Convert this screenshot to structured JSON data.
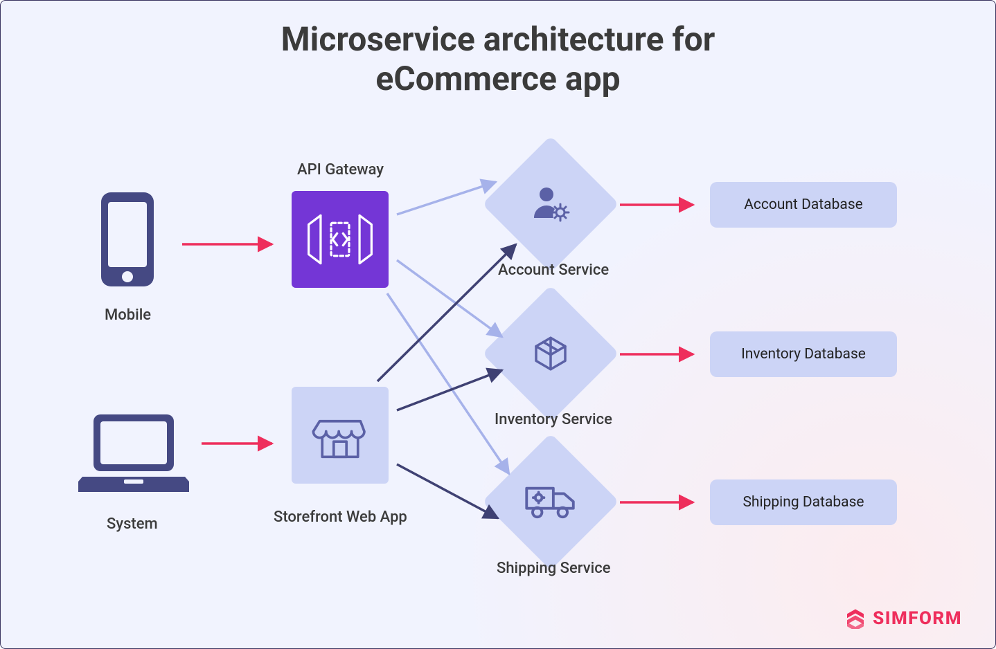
{
  "title": "Microservice architecture for\neCommerce app",
  "clients": {
    "mobile_label": "Mobile",
    "system_label": "System"
  },
  "middle": {
    "api_gateway_label": "API Gateway",
    "storefront_label": "Storefront Web App"
  },
  "services": {
    "account_label": "Account Service",
    "inventory_label": "Inventory Service",
    "shipping_label": "Shipping Service"
  },
  "databases": {
    "account_label": "Account Database",
    "inventory_label": "Inventory Database",
    "shipping_label": "Shipping Database"
  },
  "brand": "SIMFORM",
  "colors": {
    "accent_red": "#ee2e5c",
    "arrow_light": "#a6b2ea",
    "arrow_dark": "#3f4173",
    "node_fill": "#ccd4f6",
    "gateway_fill": "#7436d6",
    "icon_dark": "#454983"
  },
  "icon_names": {
    "mobile": "mobile-icon",
    "laptop": "laptop-icon",
    "api_gateway": "api-gateway-icon",
    "storefront": "storefront-icon",
    "account": "user-gear-icon",
    "inventory": "inventory-icon",
    "shipping": "truck-icon",
    "brand": "simform-logo-icon"
  },
  "arrows": [
    {
      "from": "mobile",
      "to": "api_gateway",
      "color": "accent_red"
    },
    {
      "from": "system",
      "to": "storefront",
      "color": "accent_red"
    },
    {
      "from": "api_gateway",
      "to": "account_service",
      "color": "arrow_light"
    },
    {
      "from": "api_gateway",
      "to": "inventory_service",
      "color": "arrow_light"
    },
    {
      "from": "api_gateway",
      "to": "shipping_service",
      "color": "arrow_light"
    },
    {
      "from": "storefront",
      "to": "account_service",
      "color": "arrow_dark"
    },
    {
      "from": "storefront",
      "to": "inventory_service",
      "color": "arrow_dark"
    },
    {
      "from": "storefront",
      "to": "shipping_service",
      "color": "arrow_dark"
    },
    {
      "from": "account_service",
      "to": "account_database",
      "color": "accent_red"
    },
    {
      "from": "inventory_service",
      "to": "inventory_database",
      "color": "accent_red"
    },
    {
      "from": "shipping_service",
      "to": "shipping_database",
      "color": "accent_red"
    }
  ]
}
